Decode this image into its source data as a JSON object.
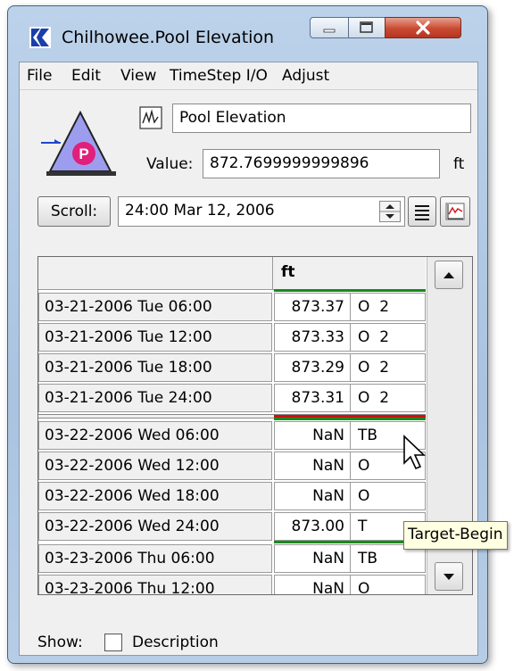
{
  "window": {
    "title": "Chilhowee.Pool Elevation"
  },
  "menu": [
    "File",
    "Edit",
    "View",
    "TimeStep I/O",
    "Adjust"
  ],
  "slot": {
    "name": "Pool Elevation",
    "value_label": "Value:",
    "value": "872.7699999999896",
    "units": "ft",
    "icon_letter": "P"
  },
  "scroll": {
    "button_label": "Scroll:",
    "datetime": "24:00 Mar 12, 2006"
  },
  "table": {
    "column_header": "ft",
    "rows": [
      {
        "date": "03-21-2006 Tue 06:00",
        "value": "873.37",
        "flag": "O  2"
      },
      {
        "date": "03-21-2006 Tue 12:00",
        "value": "873.33",
        "flag": "O  2"
      },
      {
        "date": "03-21-2006 Tue 18:00",
        "value": "873.29",
        "flag": "O  2"
      },
      {
        "date": "03-21-2006 Tue 24:00",
        "value": "873.31",
        "flag": "O  2"
      },
      {
        "date": "03-22-2006 Wed 06:00",
        "value": "NaN",
        "flag": "TB"
      },
      {
        "date": "03-22-2006 Wed 12:00",
        "value": "NaN",
        "flag": "O"
      },
      {
        "date": "03-22-2006 Wed 18:00",
        "value": "NaN",
        "flag": "O"
      },
      {
        "date": "03-22-2006 Wed 24:00",
        "value": "873.00",
        "flag": "T"
      },
      {
        "date": "03-23-2006 Thu 06:00",
        "value": "NaN",
        "flag": "TB"
      },
      {
        "date": "03-23-2006 Thu 12:00",
        "value": "NaN",
        "flag": "O"
      }
    ]
  },
  "tooltip": "Target-Begin",
  "footer": {
    "show_label": "Show:",
    "description_label": "Description",
    "description_checked": false
  },
  "colors": {
    "green_marker": "#1a8a1a",
    "red_marker": "#cc1111",
    "icon_triangle": "#9d9df0",
    "icon_circle": "#e0207a"
  }
}
